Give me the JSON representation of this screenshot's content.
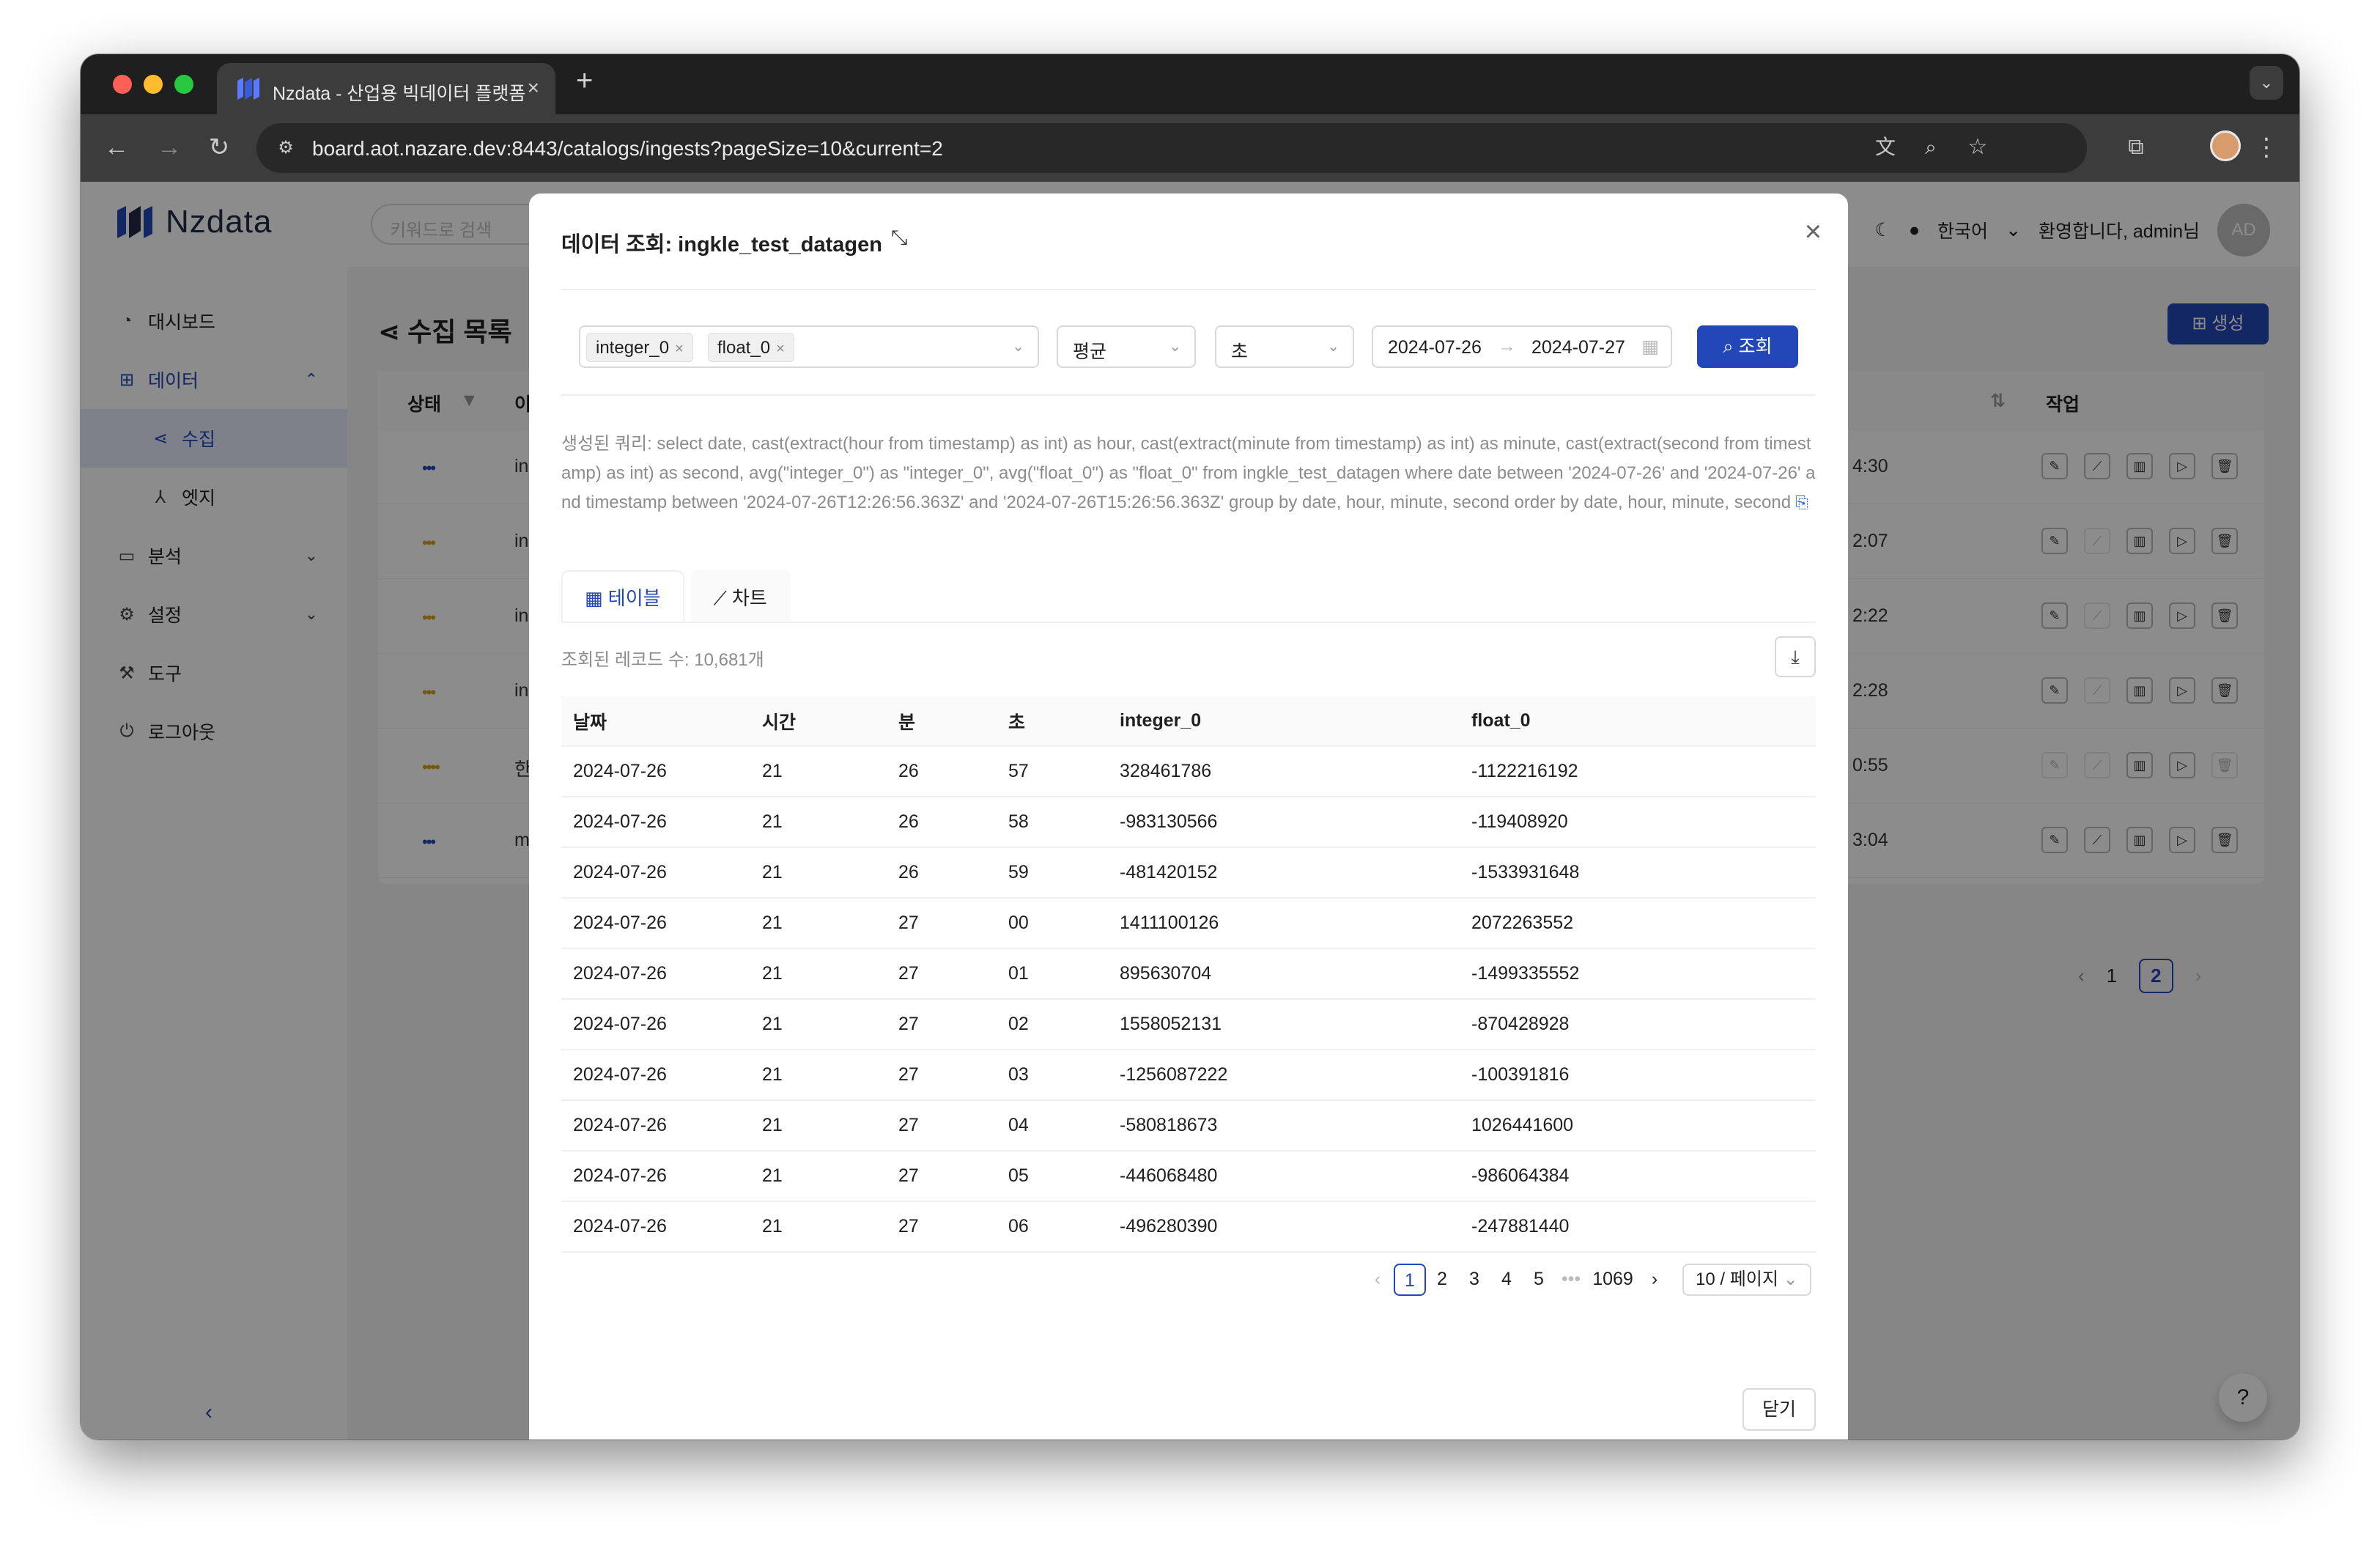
{
  "browser": {
    "tab_title": "Nzdata - 산업용 빅데이터 플랫폼",
    "tab_close": "×",
    "new_tab": "+",
    "url": "board.aot.nazare.dev:8443/catalogs/ingests?pageSize=10&current=2",
    "window_dots": [
      "#ff5f57",
      "#febc2e",
      "#28c840"
    ]
  },
  "app": {
    "logo_text": "Nzdata",
    "search_placeholder": "키워드로 검색",
    "language": "한국어",
    "welcome": "환영합니다, admin님",
    "avatar_initials": "AD",
    "nav": [
      {
        "label": "대시보드",
        "icon": "dashboard-icon"
      },
      {
        "label": "데이터",
        "icon": "grid-icon"
      },
      {
        "label": "수집",
        "icon": "share-icon"
      },
      {
        "label": "엣지",
        "icon": "nodes-icon"
      },
      {
        "label": "분석",
        "icon": "monitor-icon"
      },
      {
        "label": "설정",
        "icon": "gear-icon"
      },
      {
        "label": "도구",
        "icon": "wrench-icon"
      },
      {
        "label": "로그아웃",
        "icon": "logout-icon"
      }
    ],
    "page_title": "수집 목록",
    "create_button": "생성",
    "list_headers": {
      "status": "상태",
      "name": "이",
      "action": "작업"
    },
    "rows": [
      {
        "status": "•••",
        "status_color": "#2347b8",
        "name": "ing",
        "time": "4:30"
      },
      {
        "status": "•••",
        "status_color": "#d4a017",
        "name": "ing",
        "time": "2:07"
      },
      {
        "status": "•••",
        "status_color": "#d4a017",
        "name": "ing",
        "time": "2:22"
      },
      {
        "status": "•••",
        "status_color": "#d4a017",
        "name": "ing",
        "time": "2:28"
      },
      {
        "status": "••••",
        "status_color": "#d4a017",
        "name": "한",
        "time": "0:55"
      },
      {
        "status": "•••",
        "status_color": "#2347b8",
        "name": "mi",
        "time": "3:04"
      }
    ],
    "bg_pages": [
      "1",
      "2"
    ]
  },
  "modal": {
    "title": "데이터 조회: ingkle_test_datagen",
    "tags": [
      "integer_0",
      "float_0"
    ],
    "aggregate": "평균",
    "unit": "초",
    "date_start": "2024-07-26",
    "date_end": "2024-07-27",
    "search_button": "조회",
    "query": "생성된 쿼리: select date, cast(extract(hour from timestamp) as int) as hour, cast(extract(minute from timestamp) as int) as minute, cast(extract(second from timestamp) as int) as second, avg(\"integer_0\") as \"integer_0\", avg(\"float_0\") as \"float_0\" from ingkle_test_datagen where date between '2024-07-26' and '2024-07-26' and timestamp between '2024-07-26T12:26:56.363Z' and '2024-07-26T15:26:56.363Z' group by date, hour, minute, second order by date, hour, minute, second",
    "tab_table": "테이블",
    "tab_chart": "차트",
    "record_count": "조회된 레코드 수: 10,681개",
    "columns": [
      "날짜",
      "시간",
      "분",
      "초",
      "integer_0",
      "float_0"
    ],
    "rows": [
      [
        "2024-07-26",
        "21",
        "26",
        "57",
        "328461786",
        "-1122216192"
      ],
      [
        "2024-07-26",
        "21",
        "26",
        "58",
        "-983130566",
        "-119408920"
      ],
      [
        "2024-07-26",
        "21",
        "26",
        "59",
        "-481420152",
        "-1533931648"
      ],
      [
        "2024-07-26",
        "21",
        "27",
        "00",
        "1411100126",
        "2072263552"
      ],
      [
        "2024-07-26",
        "21",
        "27",
        "01",
        "895630704",
        "-1499335552"
      ],
      [
        "2024-07-26",
        "21",
        "27",
        "02",
        "1558052131",
        "-870428928"
      ],
      [
        "2024-07-26",
        "21",
        "27",
        "03",
        "-1256087222",
        "-100391816"
      ],
      [
        "2024-07-26",
        "21",
        "27",
        "04",
        "-580818673",
        "1026441600"
      ],
      [
        "2024-07-26",
        "21",
        "27",
        "05",
        "-446068480",
        "-986064384"
      ],
      [
        "2024-07-26",
        "21",
        "27",
        "06",
        "-496280390",
        "-247881440"
      ]
    ],
    "pages": [
      "1",
      "2",
      "3",
      "4",
      "5",
      "•••",
      "1069"
    ],
    "page_size": "10 / 페이지",
    "close_button": "닫기"
  }
}
